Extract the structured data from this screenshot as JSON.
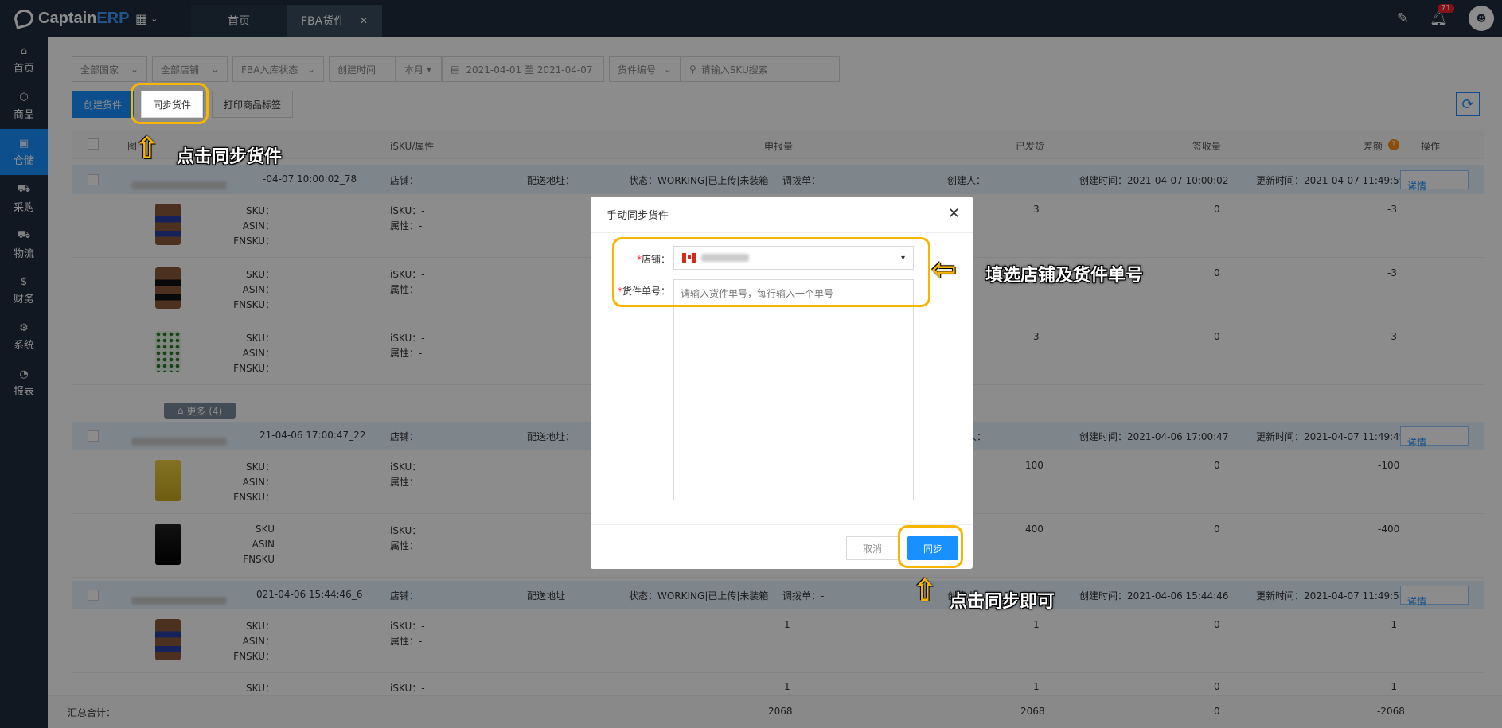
{
  "app": {
    "logo_a": "Captain",
    "logo_b": "ERP",
    "notifications": "71"
  },
  "tabs": [
    {
      "label": "首页"
    },
    {
      "label": "FBA货件",
      "close": "✕"
    }
  ],
  "sidebar": [
    {
      "label": "首页",
      "icon": "⌂"
    },
    {
      "label": "商品",
      "icon": "⬡"
    },
    {
      "label": "仓储",
      "icon": "▣"
    },
    {
      "label": "采购",
      "icon": "⛟"
    },
    {
      "label": "物流",
      "icon": "⛟"
    },
    {
      "label": "财务",
      "icon": "$"
    },
    {
      "label": "系统",
      "icon": "⚙"
    },
    {
      "label": "报表",
      "icon": "◔"
    }
  ],
  "filters": {
    "country": "全部国家",
    "store": "全部店铺",
    "status": "FBA入库状态",
    "time_type": "创建时间",
    "period": "本月",
    "date_range": "2021-04-01 至 2021-04-07",
    "field": "货件编号",
    "search_placeholder": "请输入SKU搜索"
  },
  "actions": {
    "create": "创建货件",
    "sync": "同步货件",
    "print": "打印商品标签"
  },
  "columns": {
    "sku": "iSKU/属性",
    "declared": "申报量",
    "shipped": "已发货",
    "received": "签收量",
    "diff": "差额",
    "ops": "操作"
  },
  "groups": [
    {
      "time": "-04-07 10:00:02_78",
      "store": "店铺：",
      "addr": "配送地址：",
      "status": "状态：WORKING|已上传|未装箱",
      "transfer": "调拨单：-",
      "creator": "创建人：",
      "created": "创建时间：2021-04-07 10:00:02",
      "updated": "更新时间：2021-04-07 11:49:59",
      "detail": "详情"
    },
    {
      "time": "21-04-06 17:00:47_22",
      "store": "店铺：",
      "addr": "配送地址：",
      "creator": "人：",
      "created": "创建时间：2021-04-06 17:00:47",
      "updated": "更新时间：2021-04-07 11:49:49",
      "detail": "详情"
    },
    {
      "time": "021-04-06 15:44:46_6",
      "store": "店铺：",
      "addr": "配送地址",
      "status": "状态：WORKING|已上传|未装箱",
      "transfer": "调拨单：-",
      "creator": "创建人：",
      "created": "创建时间：2021-04-06 15:44:46",
      "updated": "更新时间：2021-04-07 11:49:57",
      "detail": "详情"
    }
  ],
  "rows": [
    {
      "sku": "SKU：",
      "asin": "ASIN：",
      "fnsku": "FNSKU：",
      "isku": "iSKU：-",
      "attr": "属性：-",
      "declared": "",
      "shipped": "3",
      "received": "0",
      "diff": "-3"
    },
    {
      "sku": "SKU：",
      "asin": "ASIN：",
      "fnsku": "FNSKU：",
      "isku": "iSKU：-",
      "attr": "属性：-",
      "declared": "",
      "shipped": "",
      "received": "0",
      "diff": "-3"
    },
    {
      "sku": "SKU：",
      "asin": "ASIN：",
      "fnsku": "FNSKU：",
      "isku": "iSKU：-",
      "attr": "属性：-",
      "declared": "",
      "shipped": "3",
      "received": "0",
      "diff": "-3"
    },
    {
      "sku": "SKU：",
      "asin": "ASIN：",
      "fnsku": "FNSKU：",
      "isku": "iSKU：",
      "attr": "属性：",
      "declared": "",
      "shipped": "100",
      "received": "0",
      "diff": "-100"
    },
    {
      "sku": "SKU",
      "asin": "ASIN",
      "fnsku": "FNSKU",
      "isku": "iSKU：",
      "attr": "属性：",
      "declared": "",
      "shipped": "400",
      "received": "0",
      "diff": "-400"
    },
    {
      "sku": "SKU：",
      "asin": "ASIN：",
      "fnsku": "FNSKU：",
      "isku": "iSKU：-",
      "attr": "属性：-",
      "declared": "1",
      "shipped": "1",
      "received": "0",
      "diff": "-1"
    },
    {
      "sku": "SKU：",
      "asin": "",
      "fnsku": "",
      "isku": "iSKU：-",
      "attr": "",
      "declared": "1",
      "shipped": "1",
      "received": "0",
      "diff": "-1"
    }
  ],
  "more": "更多 (4)",
  "summary": {
    "label": "汇总合计：",
    "declared": "2068",
    "shipped": "2068",
    "received": "0",
    "diff": "-2068"
  },
  "modal": {
    "title": "手动同步货件",
    "store_label": "店铺：",
    "shipment_label": "货件单号：",
    "shipment_placeholder": "请输入货件单号，每行输入一个单号",
    "cancel": "取消",
    "confirm": "同步"
  },
  "annotations": {
    "a1": "点击同步货件",
    "a2": "填选店铺及货件单号",
    "a3": "点击同步即可"
  },
  "colors": {
    "primary": "#1890ff",
    "highlight": "#f7b500",
    "nav": "#1f2d3d"
  }
}
